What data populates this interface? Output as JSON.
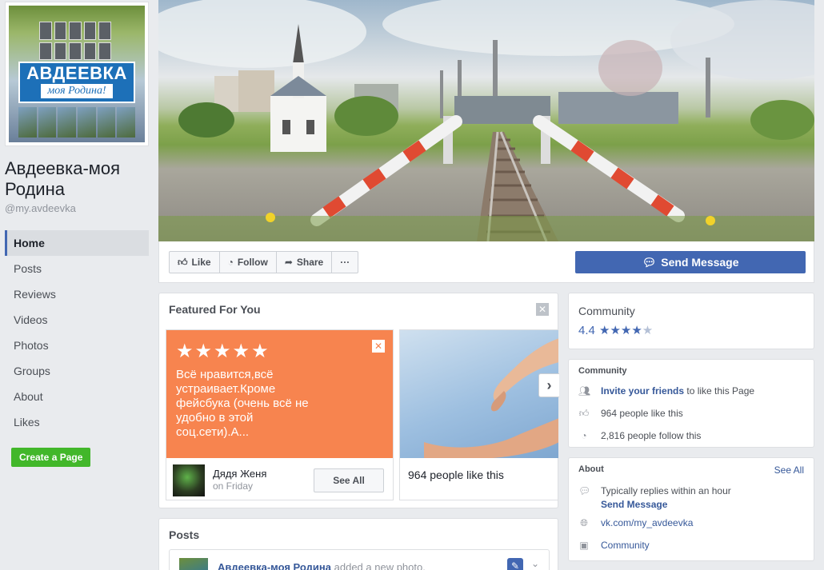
{
  "page": {
    "name": "Авдеевка-моя Родина",
    "handle": "@my.avdeevka",
    "logo_title": "АВДЕЕВКА",
    "logo_subtitle": "моя Родина!"
  },
  "nav": {
    "items": [
      {
        "label": "Home",
        "active": true
      },
      {
        "label": "Posts"
      },
      {
        "label": "Reviews"
      },
      {
        "label": "Videos"
      },
      {
        "label": "Photos"
      },
      {
        "label": "Groups"
      },
      {
        "label": "About"
      },
      {
        "label": "Likes"
      }
    ],
    "create_page": "Create a Page"
  },
  "actions": {
    "like": "Like",
    "follow": "Follow",
    "share": "Share",
    "more": "···",
    "send_message": "Send Message"
  },
  "featured": {
    "title": "Featured For You",
    "close": "✕",
    "review": {
      "stars": "★★★★★",
      "text": "Всё нравится,всё устраивает.Кроме фейсбука (очень всё не удобно в этой соц.сети).А...",
      "author": "Дядя Женя",
      "time": "on Friday",
      "see_all": "See All"
    },
    "likes_card": {
      "text": "964 people like this"
    },
    "next": "›"
  },
  "posts": {
    "title": "Posts",
    "first_post_author": "Авдеевка-моя Родина",
    "first_post_action": "added a new photo."
  },
  "rating": {
    "title": "Community",
    "value": "4.4",
    "stars": "★★★★",
    "half_star": "★"
  },
  "community": {
    "title": "Community",
    "invite_link": "Invite your friends",
    "invite_rest": " to like this Page",
    "likes": "964 people like this",
    "follows": "2,816 people follow this"
  },
  "about": {
    "title": "About",
    "see_all": "See All",
    "replies": "Typically replies within an hour",
    "send_message": "Send Message",
    "website": "vk.com/my_avdeevka",
    "category": "Community"
  },
  "colors": {
    "accent": "#4267b2",
    "review_bg": "#f7844f",
    "create_page_bg": "#42b72a"
  }
}
